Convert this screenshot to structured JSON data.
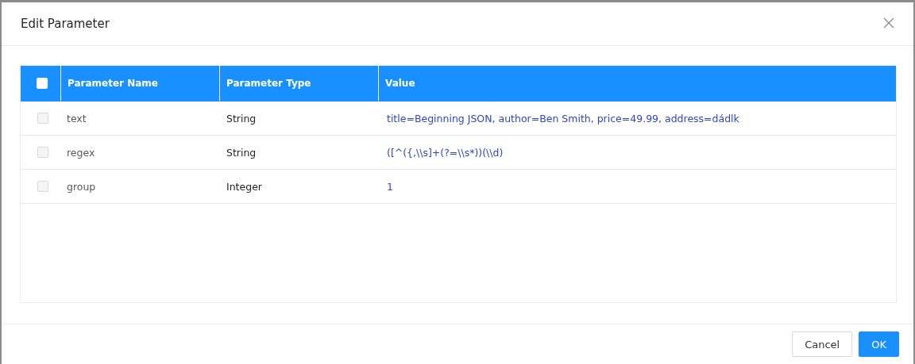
{
  "dialog": {
    "title": "Edit Parameter"
  },
  "table": {
    "select_all": {
      "checked": false
    },
    "columns": [
      "Parameter Name",
      "Parameter Type",
      "Value"
    ],
    "rows": [
      {
        "checked": false,
        "disabled": true,
        "name": "text",
        "type": "String",
        "value": "title=Beginning JSON, author=Ben Smith, price=49.99, address=dádlk"
      },
      {
        "checked": false,
        "disabled": true,
        "name": "regex",
        "type": "String",
        "value": "([^({,\\\\s]+(?=\\\\s*))(\\\\d)"
      },
      {
        "checked": false,
        "disabled": true,
        "name": "group",
        "type": "Integer",
        "value": "1"
      }
    ]
  },
  "buttons": [
    {
      "kind": "default",
      "label": "Cancel"
    },
    {
      "kind": "primary",
      "label": "OK"
    }
  ]
}
